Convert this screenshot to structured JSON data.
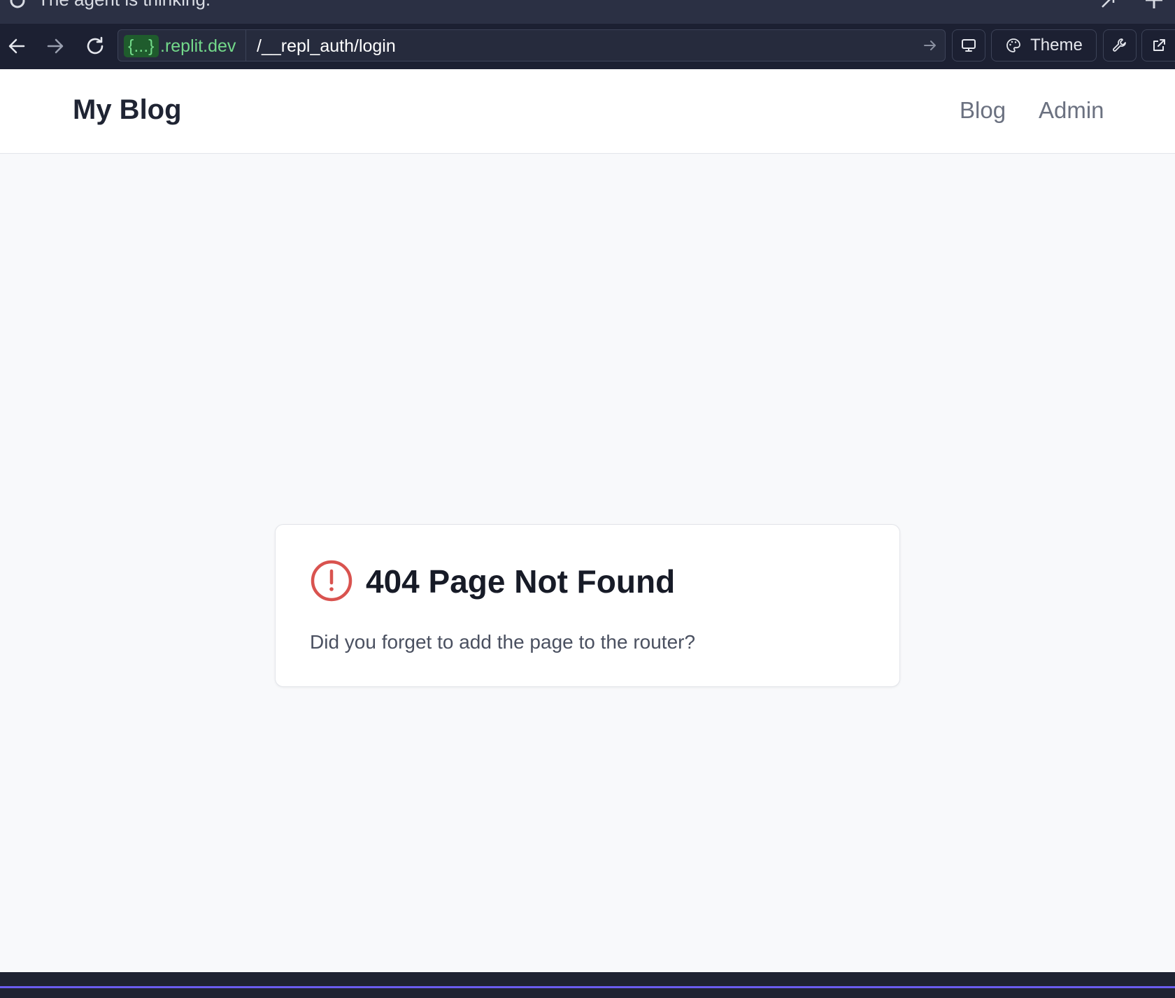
{
  "status_strip": {
    "text": "The agent is thinking."
  },
  "browser": {
    "domain_chip": "{...}",
    "domain_suffix": ".replit.dev",
    "path": "/__repl_auth/login",
    "theme_label": "Theme"
  },
  "site": {
    "title": "My Blog",
    "nav": [
      {
        "label": "Blog"
      },
      {
        "label": "Admin"
      }
    ]
  },
  "error_card": {
    "title": "404 Page Not Found",
    "message": "Did you forget to add the page to the router?"
  },
  "colors": {
    "domain_green": "#73d98a",
    "alert_red": "#d9534f",
    "accent_purple": "#6b5cf0"
  }
}
